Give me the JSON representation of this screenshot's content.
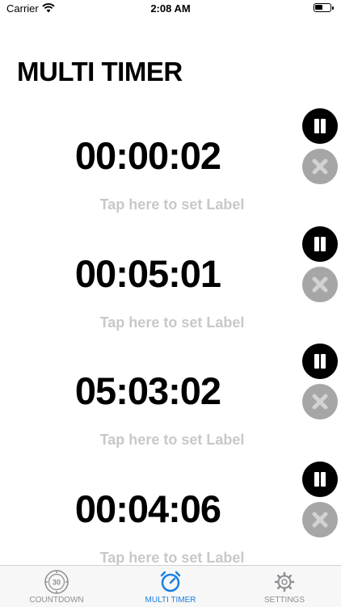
{
  "status_bar": {
    "carrier": "Carrier",
    "time": "2:08 AM"
  },
  "title": "MULTI TIMER",
  "timers": [
    {
      "time": "00:00:02",
      "label": "Tap here to set Label"
    },
    {
      "time": "00:05:01",
      "label": "Tap here to set Label"
    },
    {
      "time": "05:03:02",
      "label": "Tap here to set Label"
    },
    {
      "time": "00:04:06",
      "label": "Tap here to set Label"
    }
  ],
  "tabs": [
    {
      "label": "COUNTDOWN",
      "icon": "countdown-dial-icon",
      "active": false
    },
    {
      "label": "MULTI TIMER",
      "icon": "stopwatch-icon",
      "active": true
    },
    {
      "label": "SETTINGS",
      "icon": "gear-icon",
      "active": false
    }
  ],
  "countdown_icon_text": "30",
  "colors": {
    "accent": "#1a7fe0",
    "inactive_tab": "#8e8e93",
    "label_gray": "#c8c8c8",
    "delete_gray": "#a6a6a6"
  }
}
